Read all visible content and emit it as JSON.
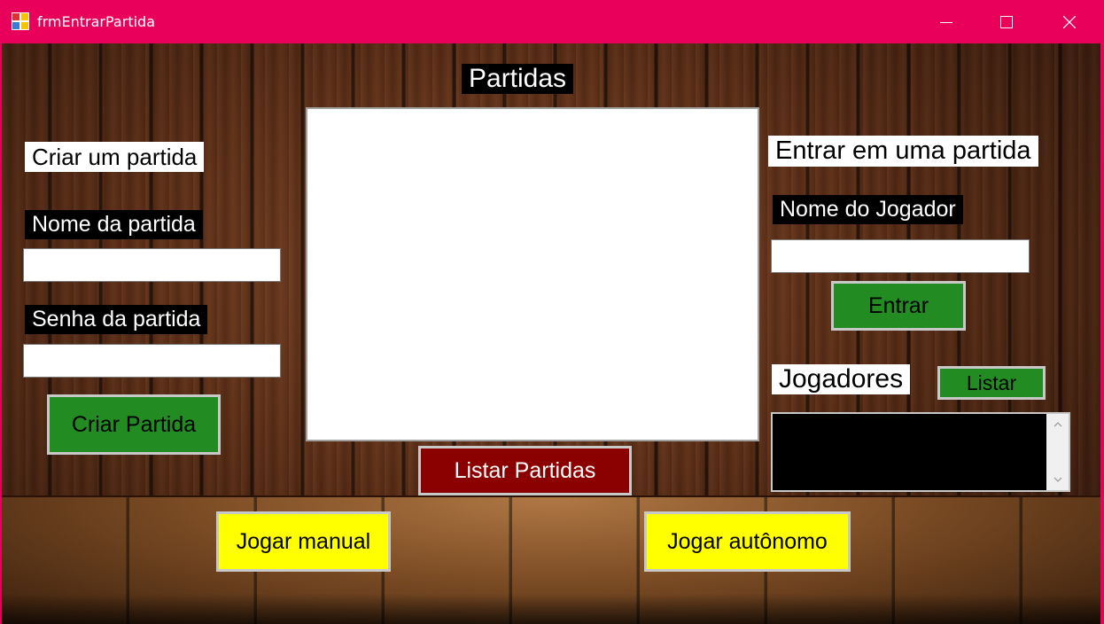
{
  "window": {
    "title": "frmEntrarPartida"
  },
  "create": {
    "heading": "Criar um partida",
    "name_label": "Nome da partida",
    "name_value": "",
    "password_label": "Senha da partida",
    "password_value": "",
    "create_button": "Criar Partida"
  },
  "matches": {
    "heading": "Partidas",
    "items": [],
    "list_button": "Listar Partidas"
  },
  "join": {
    "heading": "Entrar em uma partida",
    "player_label": "Nome do Jogador",
    "player_value": "",
    "enter_button": "Entrar"
  },
  "players": {
    "heading": "Jogadores",
    "list_button": "Listar",
    "text": ""
  },
  "play": {
    "manual_button": "Jogar manual",
    "autonomous_button": "Jogar autônomo"
  },
  "colors": {
    "titlebar": "#e8005a",
    "green_button": "#228b22",
    "red_button": "#8b0000",
    "yellow_button": "#ffff00"
  },
  "icons": [
    "app-icon",
    "minimize-icon",
    "maximize-icon",
    "close-icon",
    "scroll-up-icon",
    "scroll-down-icon"
  ]
}
